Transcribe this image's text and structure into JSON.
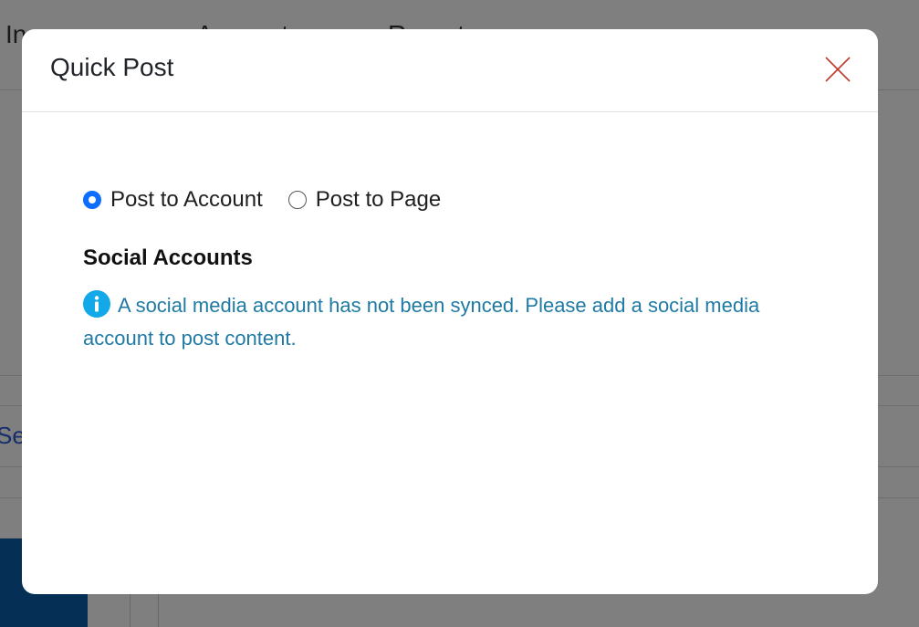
{
  "background": {
    "nav_items": [
      "In...",
      "Accounts",
      "Reports"
    ],
    "link_fragment": "Se"
  },
  "modal": {
    "title": "Quick Post",
    "close_icon": "close-icon",
    "radio_options": [
      {
        "label": "Post to Account",
        "checked": true
      },
      {
        "label": "Post to Page",
        "checked": false
      }
    ],
    "section_title": "Social Accounts",
    "info_icon": "info-icon",
    "info_message": "A social media account has not been synced. Please add a social media account to post content."
  },
  "colors": {
    "accent": "#0d6efd",
    "close": "#c0392b",
    "info": "#1f7aa3",
    "info_icon_bg": "#13a9e8"
  }
}
